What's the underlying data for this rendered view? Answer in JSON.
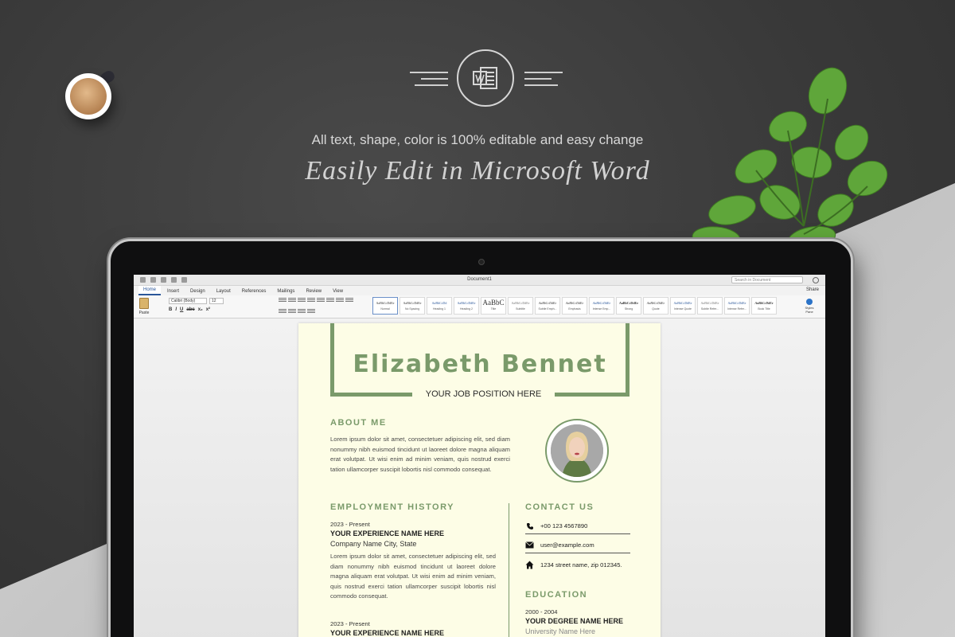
{
  "scene": {
    "tagline": "All text, shape, color is 100% editable and easy change",
    "headline": "Easily Edit in Microsoft Word"
  },
  "word": {
    "doc_title": "Document1",
    "search_placeholder": "Search in Document",
    "tabs": [
      "Home",
      "Insert",
      "Design",
      "Layout",
      "References",
      "Mailings",
      "Review",
      "View"
    ],
    "share_label": "Share",
    "paste_label": "Paste",
    "font_name": "Calibri (Body)",
    "font_size": "12",
    "format_buttons": [
      "B",
      "I",
      "U",
      "abc",
      "x₂",
      "x²"
    ],
    "styles": [
      {
        "sample": "AaBbCcDdEe",
        "label": "Normal"
      },
      {
        "sample": "AaBbCcDdEe",
        "label": "No Spacing"
      },
      {
        "sample": "AaBbCcDd",
        "label": "Heading 1"
      },
      {
        "sample": "AaBbCcDdEe",
        "label": "Heading 2"
      },
      {
        "sample": "AaBbC",
        "label": "Title"
      },
      {
        "sample": "AaBbCcDdEe",
        "label": "Subtitle"
      },
      {
        "sample": "AaBbCcDdEe",
        "label": "Subtle Emph..."
      },
      {
        "sample": "AaBbCcDdEe",
        "label": "Emphasis"
      },
      {
        "sample": "AaBbCcDdEe",
        "label": "Intense Emp..."
      },
      {
        "sample": "AaBbCcDdEe",
        "label": "Strong"
      },
      {
        "sample": "AaBbCcDdEe",
        "label": "Quote"
      },
      {
        "sample": "AaBbCcDdEe",
        "label": "Intense Quote"
      },
      {
        "sample": "AaBbCcDdEe",
        "label": "Subtle Refer..."
      },
      {
        "sample": "AaBbCcDdEe",
        "label": "Intense Refer..."
      },
      {
        "sample": "AaBbCcDdEe",
        "label": "Book Title"
      }
    ],
    "styles_pane_label": "Styles Pane"
  },
  "resume": {
    "name": "Elizabeth Bennet",
    "job_position": "YOUR JOB POSITION HERE",
    "about_title": "ABOUT ME",
    "about_text": "Lorem ipsum dolor sit amet, consectetuer adipiscing elit, sed diam nonummy nibh euismod tincidunt ut laoreet dolore magna aliquam erat volutpat. Ut wisi enim ad minim veniam, quis nostrud exerci tation ullamcorper suscipit lobortis nisl commodo consequat.",
    "employment_title": "EMPLOYMENT HISTORY",
    "jobs": [
      {
        "dates": "2023 - Present",
        "role": "YOUR EXPERIENCE NAME HERE",
        "company": "Company Name City, State",
        "description": "Lorem ipsum dolor sit amet, consectetuer adipiscing elit, sed diam nonummy nibh euismod tincidunt ut laoreet dolore magna aliquam erat volutpat. Ut wisi enim ad minim veniam, quis nostrud exerci tation ullamcorper suscipit lobortis nisl commodo consequat."
      },
      {
        "dates": "2023 - Present",
        "role": "YOUR EXPERIENCE NAME HERE"
      }
    ],
    "contact_title": "CONTACT US",
    "contact": {
      "phone": "+00 123 4567890",
      "email": "user@example.com",
      "address": "1234 street name, zip 012345."
    },
    "education_title": "EDUCATION",
    "education": {
      "dates": "2000 - 2004",
      "degree": "YOUR DEGREE NAME HERE",
      "university": "University Name Here"
    }
  },
  "colors": {
    "accent_green": "#7a9a6a",
    "page_cream": "#fdfde6",
    "word_blue": "#2b579a"
  }
}
